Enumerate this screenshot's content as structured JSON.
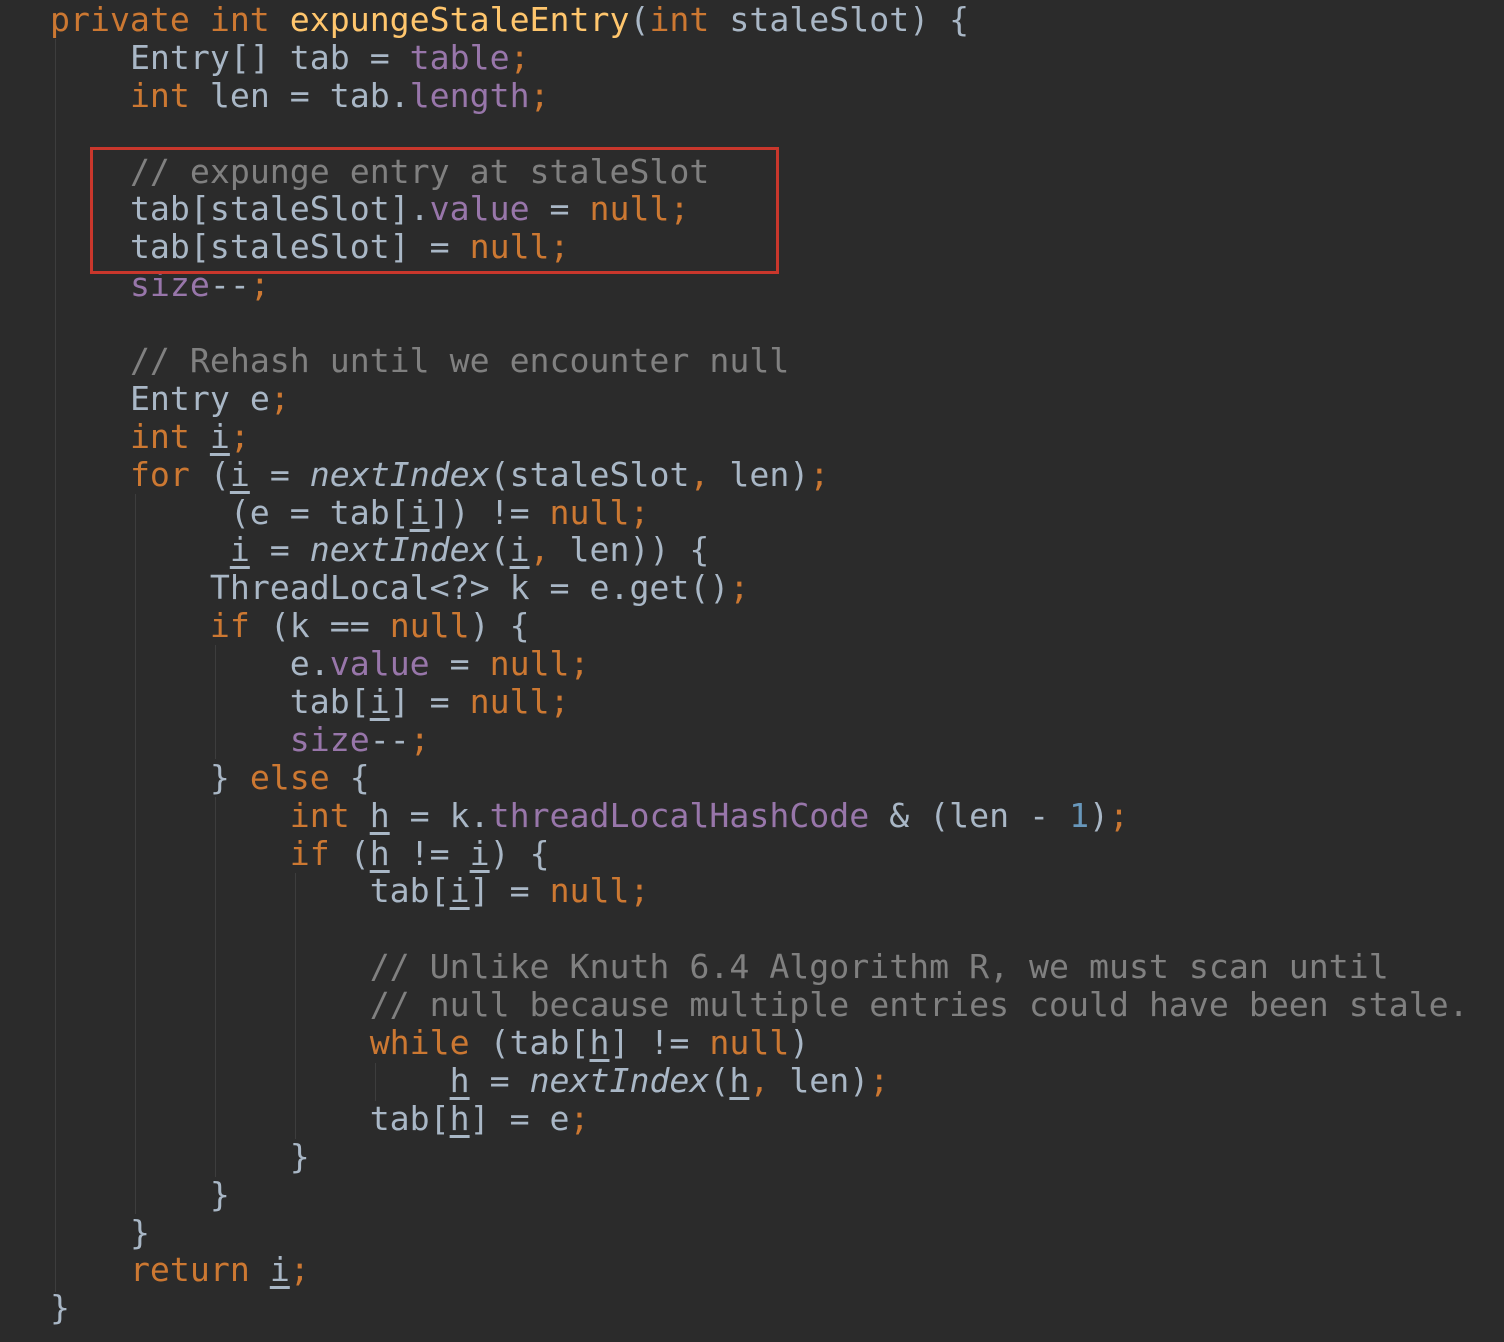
{
  "editor": {
    "highlight_color": "#c9372c",
    "colors": {
      "background": "#2b2b2b",
      "default": "#a9b7c6",
      "keyword": "#cc7832",
      "method": "#ffc66d",
      "field": "#9876aa",
      "comment": "#808080",
      "number": "#6897bb"
    },
    "lines": [
      {
        "indent": 0,
        "tokens": [
          [
            "private int ",
            "kw"
          ],
          [
            "expungeStaleEntry",
            "fn"
          ],
          [
            "(",
            ""
          ],
          [
            "int ",
            "kw"
          ],
          [
            "staleSlot) {",
            ""
          ]
        ]
      },
      {
        "indent": 4,
        "tokens": [
          [
            "Entry[] tab = ",
            ""
          ],
          [
            "table",
            "fld"
          ],
          [
            ";",
            "kw"
          ]
        ]
      },
      {
        "indent": 4,
        "tokens": [
          [
            "int ",
            "kw"
          ],
          [
            "len = tab.",
            ""
          ],
          [
            "length",
            "fld"
          ],
          [
            ";",
            "kw"
          ]
        ]
      },
      {
        "indent": 0,
        "tokens": []
      },
      {
        "indent": 4,
        "tokens": [
          [
            "// expunge entry at staleSlot",
            "cm"
          ]
        ]
      },
      {
        "indent": 4,
        "tokens": [
          [
            "tab[staleSlot].",
            ""
          ],
          [
            "value",
            "fld"
          ],
          [
            " = ",
            ""
          ],
          [
            "null;",
            "kw"
          ]
        ]
      },
      {
        "indent": 4,
        "tokens": [
          [
            "tab[staleSlot] = ",
            ""
          ],
          [
            "null;",
            "kw"
          ]
        ]
      },
      {
        "indent": 4,
        "tokens": [
          [
            "size",
            "fld"
          ],
          [
            "--",
            ""
          ],
          [
            ";",
            "kw"
          ]
        ]
      },
      {
        "indent": 0,
        "tokens": []
      },
      {
        "indent": 4,
        "tokens": [
          [
            "// Rehash until we encounter null",
            "cm"
          ]
        ]
      },
      {
        "indent": 4,
        "tokens": [
          [
            "Entry e",
            ""
          ],
          [
            ";",
            "kw"
          ]
        ]
      },
      {
        "indent": 4,
        "tokens": [
          [
            "int ",
            "kw"
          ],
          [
            "i",
            "ul"
          ],
          [
            ";",
            "kw"
          ]
        ]
      },
      {
        "indent": 4,
        "tokens": [
          [
            "for ",
            "kw"
          ],
          [
            "(",
            ""
          ],
          [
            "i",
            "ul"
          ],
          [
            " = ",
            ""
          ],
          [
            "nextIndex",
            "it"
          ],
          [
            "(staleSlot",
            ""
          ],
          [
            ", ",
            "kw"
          ],
          [
            "len)",
            ""
          ],
          [
            ";",
            "kw"
          ]
        ]
      },
      {
        "indent": 9,
        "tokens": [
          [
            "(e = tab[",
            ""
          ],
          [
            "i",
            "ul"
          ],
          [
            "]) != ",
            ""
          ],
          [
            "null;",
            "kw"
          ]
        ]
      },
      {
        "indent": 9,
        "tokens": [
          [
            "i",
            "ul"
          ],
          [
            " = ",
            ""
          ],
          [
            "nextIndex",
            "it"
          ],
          [
            "(",
            ""
          ],
          [
            "i",
            "ul"
          ],
          [
            ", ",
            "kw"
          ],
          [
            "len)) {",
            ""
          ]
        ]
      },
      {
        "indent": 8,
        "tokens": [
          [
            "ThreadLocal<?> k = e.get()",
            ""
          ],
          [
            ";",
            "kw"
          ]
        ]
      },
      {
        "indent": 8,
        "tokens": [
          [
            "if ",
            "kw"
          ],
          [
            "(k == ",
            ""
          ],
          [
            "null",
            "kw"
          ],
          [
            ") {",
            ""
          ]
        ]
      },
      {
        "indent": 12,
        "tokens": [
          [
            "e.",
            ""
          ],
          [
            "value",
            "fld"
          ],
          [
            " = ",
            ""
          ],
          [
            "null;",
            "kw"
          ]
        ]
      },
      {
        "indent": 12,
        "tokens": [
          [
            "tab[",
            ""
          ],
          [
            "i",
            "ul"
          ],
          [
            "] = ",
            ""
          ],
          [
            "null;",
            "kw"
          ]
        ]
      },
      {
        "indent": 12,
        "tokens": [
          [
            "size",
            "fld"
          ],
          [
            "--",
            ""
          ],
          [
            ";",
            "kw"
          ]
        ]
      },
      {
        "indent": 8,
        "tokens": [
          [
            "} ",
            ""
          ],
          [
            "else ",
            "kw"
          ],
          [
            "{",
            ""
          ]
        ]
      },
      {
        "indent": 12,
        "tokens": [
          [
            "int ",
            "kw"
          ],
          [
            "h",
            "ul"
          ],
          [
            " = k.",
            ""
          ],
          [
            "threadLocalHashCode",
            "fld"
          ],
          [
            " & (len - ",
            ""
          ],
          [
            "1",
            "num"
          ],
          [
            ")",
            ""
          ],
          [
            ";",
            "kw"
          ]
        ]
      },
      {
        "indent": 12,
        "tokens": [
          [
            "if ",
            "kw"
          ],
          [
            "(",
            ""
          ],
          [
            "h",
            "ul"
          ],
          [
            " != ",
            ""
          ],
          [
            "i",
            "ul"
          ],
          [
            ") {",
            ""
          ]
        ]
      },
      {
        "indent": 16,
        "tokens": [
          [
            "tab[",
            ""
          ],
          [
            "i",
            "ul"
          ],
          [
            "] = ",
            ""
          ],
          [
            "null;",
            "kw"
          ]
        ]
      },
      {
        "indent": 0,
        "tokens": []
      },
      {
        "indent": 16,
        "tokens": [
          [
            "// Unlike Knuth 6.4 Algorithm R, we must scan until",
            "cm"
          ]
        ]
      },
      {
        "indent": 16,
        "tokens": [
          [
            "// null because multiple entries could have been stale.",
            "cm"
          ]
        ]
      },
      {
        "indent": 16,
        "tokens": [
          [
            "while ",
            "kw"
          ],
          [
            "(tab[",
            ""
          ],
          [
            "h",
            "ul"
          ],
          [
            "] != ",
            ""
          ],
          [
            "null",
            "kw"
          ],
          [
            ")",
            ""
          ]
        ]
      },
      {
        "indent": 20,
        "tokens": [
          [
            "h",
            "ul"
          ],
          [
            " = ",
            ""
          ],
          [
            "nextIndex",
            "it"
          ],
          [
            "(",
            ""
          ],
          [
            "h",
            "ul"
          ],
          [
            ", ",
            "kw"
          ],
          [
            "len)",
            ""
          ],
          [
            ";",
            "kw"
          ]
        ]
      },
      {
        "indent": 16,
        "tokens": [
          [
            "tab[",
            ""
          ],
          [
            "h",
            "ul"
          ],
          [
            "] = e",
            ""
          ],
          [
            ";",
            "kw"
          ]
        ]
      },
      {
        "indent": 12,
        "tokens": [
          [
            "}",
            ""
          ]
        ]
      },
      {
        "indent": 8,
        "tokens": [
          [
            "}",
            ""
          ]
        ]
      },
      {
        "indent": 4,
        "tokens": [
          [
            "}",
            ""
          ]
        ]
      },
      {
        "indent": 4,
        "tokens": [
          [
            "return ",
            "kw"
          ],
          [
            "i",
            "ul"
          ],
          [
            ";",
            "kw"
          ]
        ]
      },
      {
        "indent": 0,
        "tokens": [
          [
            "}",
            ""
          ]
        ]
      }
    ]
  }
}
